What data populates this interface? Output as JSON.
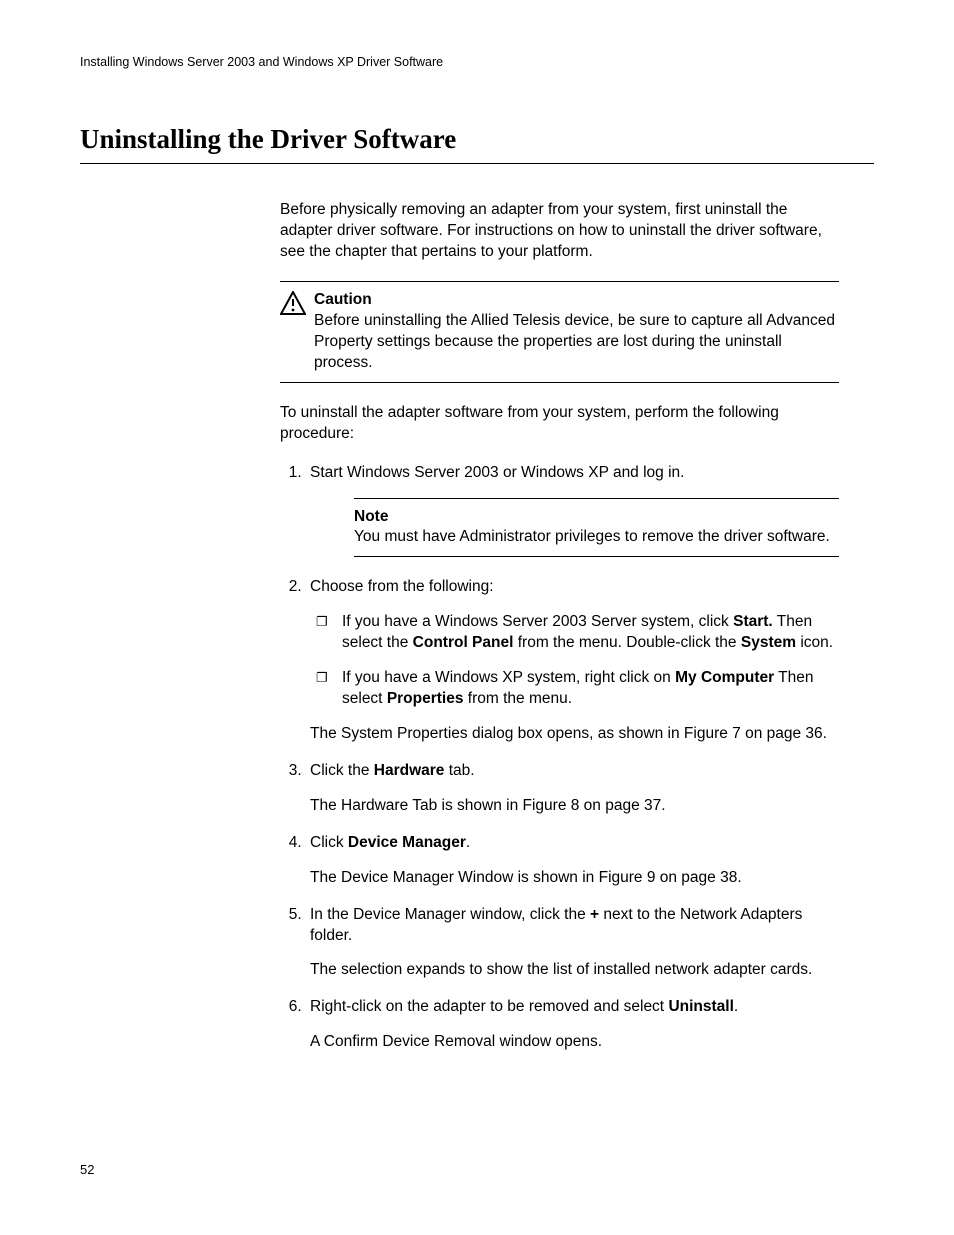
{
  "header": {
    "running": "Installing Windows Server 2003 and Windows XP Driver Software"
  },
  "section_title": "Uninstalling the Driver Software",
  "intro": "Before physically removing an adapter from your system, first uninstall the adapter driver software. For instructions on how to uninstall the driver software, see the chapter that pertains to your platform.",
  "caution": {
    "title": "Caution",
    "body": "Before uninstalling the Allied Telesis device, be sure to capture all Advanced Property settings because the properties are lost during the uninstall process."
  },
  "lead_in": "To uninstall the adapter software from your system, perform the following procedure:",
  "steps": {
    "s1": "Start Windows Server 2003 or Windows XP and log in.",
    "note": {
      "title": "Note",
      "body": "You must have Administrator privileges to remove the driver software."
    },
    "s2_lead": "Choose from the following:",
    "s2_a_pre": "If you have a Windows Server 2003 Server system, click ",
    "s2_a_b1": "Start.",
    "s2_a_mid": " Then select the ",
    "s2_a_b2": "Control Panel",
    "s2_a_mid2": " from the menu. Double-click the ",
    "s2_a_b3": "System",
    "s2_a_end": " icon.",
    "s2_b_pre": "If you have a Windows XP system, right click on ",
    "s2_b_b1": "My Computer",
    "s2_b_mid": " Then select ",
    "s2_b_b2": "Properties",
    "s2_b_end": " from the menu.",
    "s2_result": "The System Properties dialog box opens, as shown in Figure 7 on page 36.",
    "s3_pre": "Click the ",
    "s3_b": "Hardware",
    "s3_end": " tab.",
    "s3_result": "The Hardware Tab is shown in Figure 8 on page 37.",
    "s4_pre": "Click ",
    "s4_b": "Device Manager",
    "s4_end": ".",
    "s4_result": "The Device Manager Window is shown in Figure 9 on page 38.",
    "s5_pre": "In the Device Manager window, click the ",
    "s5_b": "+",
    "s5_end": " next to the Network Adapters folder.",
    "s5_result": "The selection expands to show the list of installed network adapter cards.",
    "s6_pre": "Right-click on the adapter to be removed and select ",
    "s6_b": "Uninstall",
    "s6_end": ".",
    "s6_result": "A Confirm Device Removal window opens."
  },
  "page_number": "52"
}
